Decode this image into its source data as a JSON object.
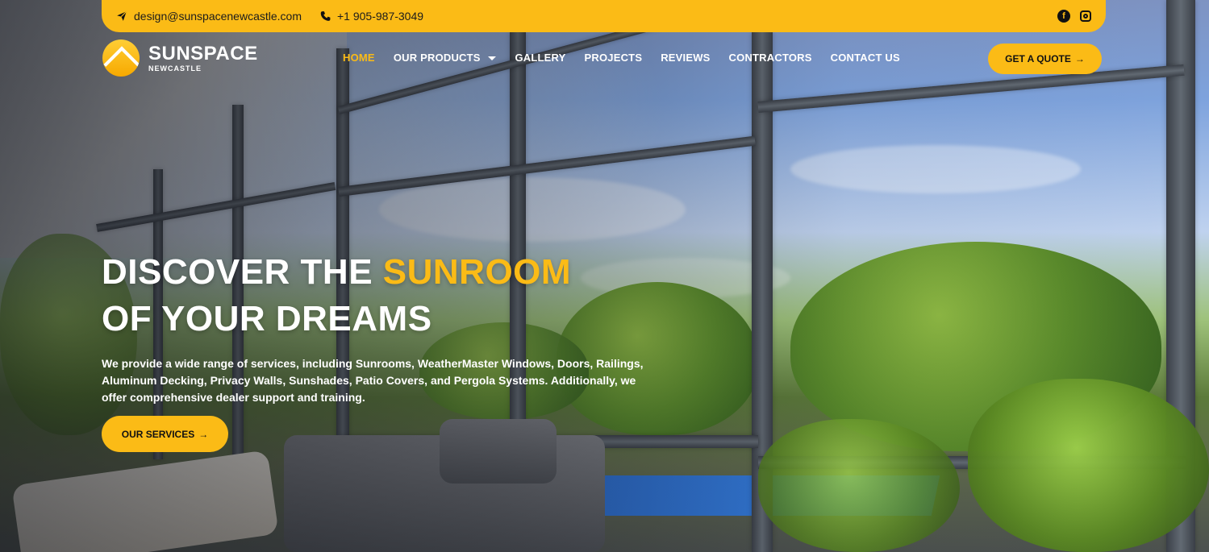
{
  "top_bar": {
    "email": "design@sunspacenewcastle.com",
    "phone": "+1 905-987-3049",
    "email_icon": "send-icon",
    "phone_icon": "phone-icon",
    "social": {
      "facebook_icon": "facebook-icon",
      "instagram_icon": "instagram-icon"
    }
  },
  "brand": {
    "name": "SUNSPACE",
    "subtitle": "NEWCASTLE"
  },
  "nav": {
    "items": [
      {
        "label": "HOME",
        "active": true
      },
      {
        "label": "OUR PRODUCTS",
        "has_dropdown": true
      },
      {
        "label": "GALLERY"
      },
      {
        "label": "PROJECTS"
      },
      {
        "label": "REVIEWS"
      },
      {
        "label": "CONTRACTORS"
      },
      {
        "label": "CONTACT US"
      }
    ]
  },
  "cta": {
    "quote": "GET A QUOTE",
    "quote_arrow": "→",
    "services": "OUR SERVICES",
    "services_arrow": "→"
  },
  "hero": {
    "headline_part1": "DISCOVER THE ",
    "headline_accent": "SUNROOM",
    "headline_part2": "OF YOUR DREAMS",
    "description": "We provide a wide range of services, including Sunrooms, WeatherMaster Windows, Doors, Railings, Aluminum Decking, Privacy Walls, Sunshades, Patio Covers, and Pergola Systems. Additionally, we offer comprehensive dealer support and training."
  },
  "colors": {
    "accent": "#fbbb16",
    "text_light": "#ffffff",
    "text_dark": "#111111"
  }
}
